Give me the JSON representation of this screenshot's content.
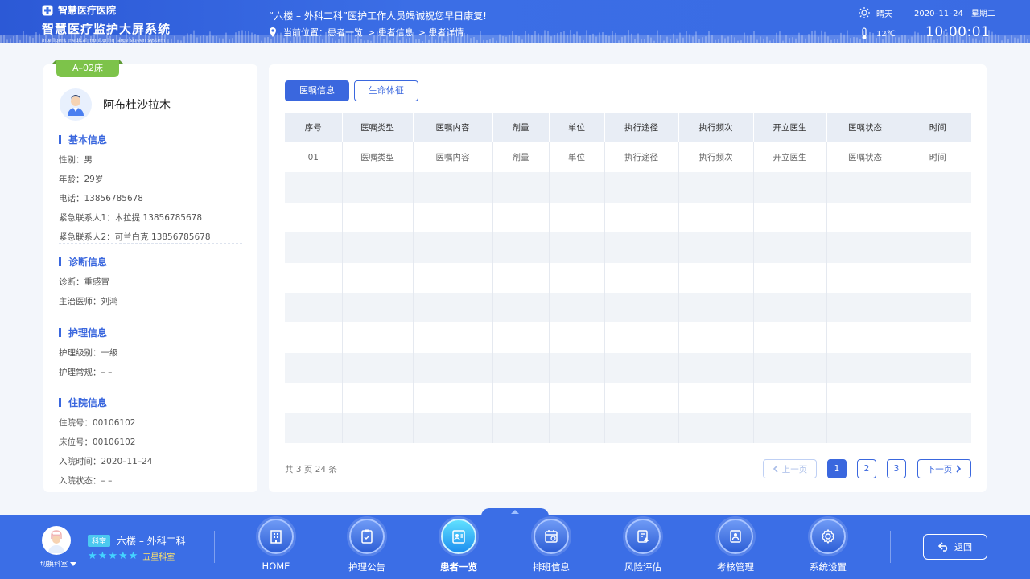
{
  "header": {
    "hospital": "智慧医疗医院",
    "system_title": "智慧医疗监护大屏系统",
    "system_subtitle": "Intelligent medical monitoring large screen system",
    "notice": "“六楼 – 外科二科”医护工作人员竭诚祝您早日康复!",
    "location_label": "当前位置：",
    "breadcrumbs": [
      "患者一览",
      "> 患者信息",
      "> 患者详情"
    ],
    "weather": "晴天",
    "temperature": "12℃",
    "date": "2020–11–24",
    "weekday": "星期二",
    "time": "10:00:01"
  },
  "patient": {
    "bed": "A–02床",
    "name": "阿布杜沙拉木",
    "sections": [
      {
        "title": "基本信息",
        "fields": [
          "性别：男",
          "年龄：29岁",
          "电话：13856785678",
          "紧急联系人1：木拉提  13856785678",
          "紧急联系人2：可兰白克  13856785678"
        ]
      },
      {
        "title": "诊断信息",
        "fields": [
          "诊断：重感冒",
          "主治医师：刘鸿"
        ]
      },
      {
        "title": "护理信息",
        "fields": [
          "护理级别：一级",
          "护理常规：– –"
        ]
      },
      {
        "title": "住院信息",
        "fields": [
          "住院号：00106102",
          "床位号：00106102",
          "入院时间：2020–11–24",
          "入院状态：– –"
        ]
      }
    ]
  },
  "tabs": [
    "医嘱信息",
    "生命体征"
  ],
  "table": {
    "columns": [
      "序号",
      "医嘱类型",
      "医嘱内容",
      "剂量",
      "单位",
      "执行途径",
      "执行频次",
      "开立医生",
      "医嘱状态",
      "时间"
    ],
    "rows": [
      [
        "01",
        "医嘱类型",
        "医嘱内容",
        "剂量",
        "单位",
        "执行途径",
        "执行频次",
        "开立医生",
        "医嘱状态",
        "时间"
      ]
    ],
    "empty_rows": 9
  },
  "pagination": {
    "total": "共 3 页 24 条",
    "prev": "上一页",
    "pages": [
      "1",
      "2",
      "3"
    ],
    "next": "下一页",
    "current_page": 1
  },
  "footer": {
    "switch_label": "切换科室",
    "dept_badge": "科室",
    "dept_name": "六楼 – 外科二科",
    "rating": "五星科室",
    "nav": [
      {
        "label": "HOME",
        "icon": "building-icon"
      },
      {
        "label": "护理公告",
        "icon": "clipboard-icon"
      },
      {
        "label": "患者一览",
        "icon": "patient-list-icon"
      },
      {
        "label": "排班信息",
        "icon": "calendar-icon"
      },
      {
        "label": "风险评估",
        "icon": "risk-icon"
      },
      {
        "label": "考核管理",
        "icon": "assessment-icon"
      },
      {
        "label": "系统设置",
        "icon": "gear-icon"
      }
    ],
    "active_nav": 2,
    "back": "返回"
  }
}
